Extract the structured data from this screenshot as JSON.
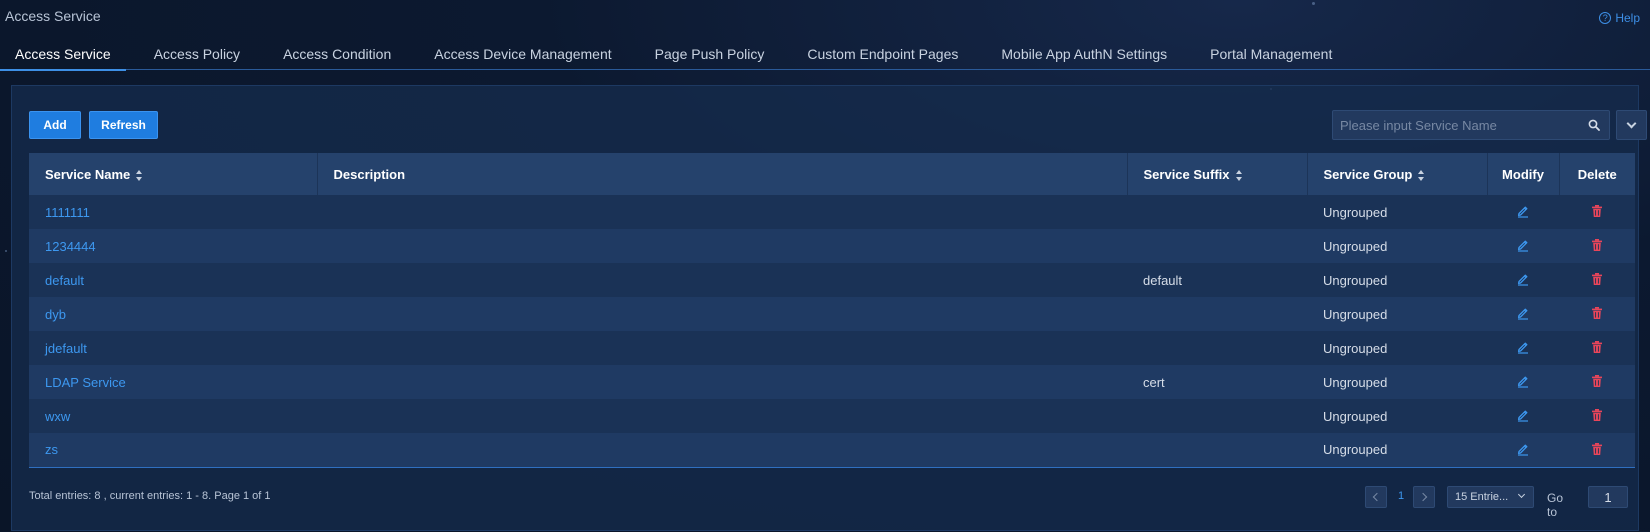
{
  "page": {
    "title": "Access Service",
    "help_label": "Help"
  },
  "tabs": [
    {
      "label": "Access Service",
      "active": true
    },
    {
      "label": "Access Policy"
    },
    {
      "label": "Access Condition"
    },
    {
      "label": "Access Device Management"
    },
    {
      "label": "Page Push Policy"
    },
    {
      "label": "Custom Endpoint Pages"
    },
    {
      "label": "Mobile App AuthN Settings"
    },
    {
      "label": "Portal Management"
    }
  ],
  "toolbar": {
    "add_label": "Add",
    "refresh_label": "Refresh",
    "search_placeholder": "Please input Service Name"
  },
  "table": {
    "columns": [
      "Service Name",
      "Description",
      "Service Suffix",
      "Service Group",
      "Modify",
      "Delete"
    ],
    "rows": [
      {
        "name": "1111111",
        "description": "",
        "suffix": "",
        "group": "Ungrouped"
      },
      {
        "name": "1234444",
        "description": "",
        "suffix": "",
        "group": "Ungrouped"
      },
      {
        "name": "default",
        "description": "",
        "suffix": "default",
        "group": "Ungrouped"
      },
      {
        "name": "dyb",
        "description": "",
        "suffix": "",
        "group": "Ungrouped"
      },
      {
        "name": "jdefault",
        "description": "",
        "suffix": "",
        "group": "Ungrouped"
      },
      {
        "name": "LDAP Service",
        "description": "",
        "suffix": "cert",
        "group": "Ungrouped"
      },
      {
        "name": "wxw",
        "description": "",
        "suffix": "",
        "group": "Ungrouped"
      },
      {
        "name": "zs",
        "description": "",
        "suffix": "",
        "group": "Ungrouped"
      }
    ]
  },
  "footer": {
    "summary": "Total entries: 8 , current entries: 1 - 8. Page 1 of 1",
    "current_page": "1",
    "page_size": "15 Entrie...",
    "goto_label": "Go to",
    "goto_value": "1"
  },
  "colors": {
    "accent": "#3d98f0",
    "delete": "#e8455a",
    "button": "#1f7de0"
  }
}
